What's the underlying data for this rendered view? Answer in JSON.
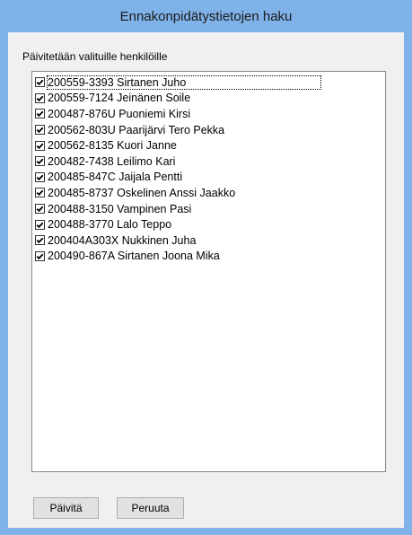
{
  "window": {
    "title": "Ennakonpidätystietojen haku"
  },
  "caption": "Päivitetään valituille henkilöille",
  "items": [
    {
      "label": "200559-3393 Sirtanen Juho",
      "checked": true
    },
    {
      "label": "200559-7124 Jeinänen Soile",
      "checked": true
    },
    {
      "label": "200487-876U Puoniemi Kirsi",
      "checked": true
    },
    {
      "label": "200562-803U Paarijärvi Tero Pekka",
      "checked": true
    },
    {
      "label": "200562-8135 Kuori Janne",
      "checked": true
    },
    {
      "label": "200482-7438 Leilimo Kari",
      "checked": true
    },
    {
      "label": "200485-847C Jaijala Pentti",
      "checked": true
    },
    {
      "label": "200485-8737 Oskelinen Anssi Jaakko",
      "checked": true
    },
    {
      "label": "200488-3150 Vampinen Pasi",
      "checked": true
    },
    {
      "label": "200488-3770 Lalo Teppo",
      "checked": true
    },
    {
      "label": "200404A303X Nukkinen Juha",
      "checked": true
    },
    {
      "label": "200490-867A Sirtanen Joona Mika",
      "checked": true
    }
  ],
  "buttons": {
    "update_label": "Päivitä",
    "cancel_label": "Peruuta"
  },
  "icons": {
    "checkmark": "checkmark-icon"
  },
  "colors": {
    "title_bar": "#7fb2e8",
    "client_bg": "#f0f0f0",
    "button_bg": "#e1e1e1"
  }
}
